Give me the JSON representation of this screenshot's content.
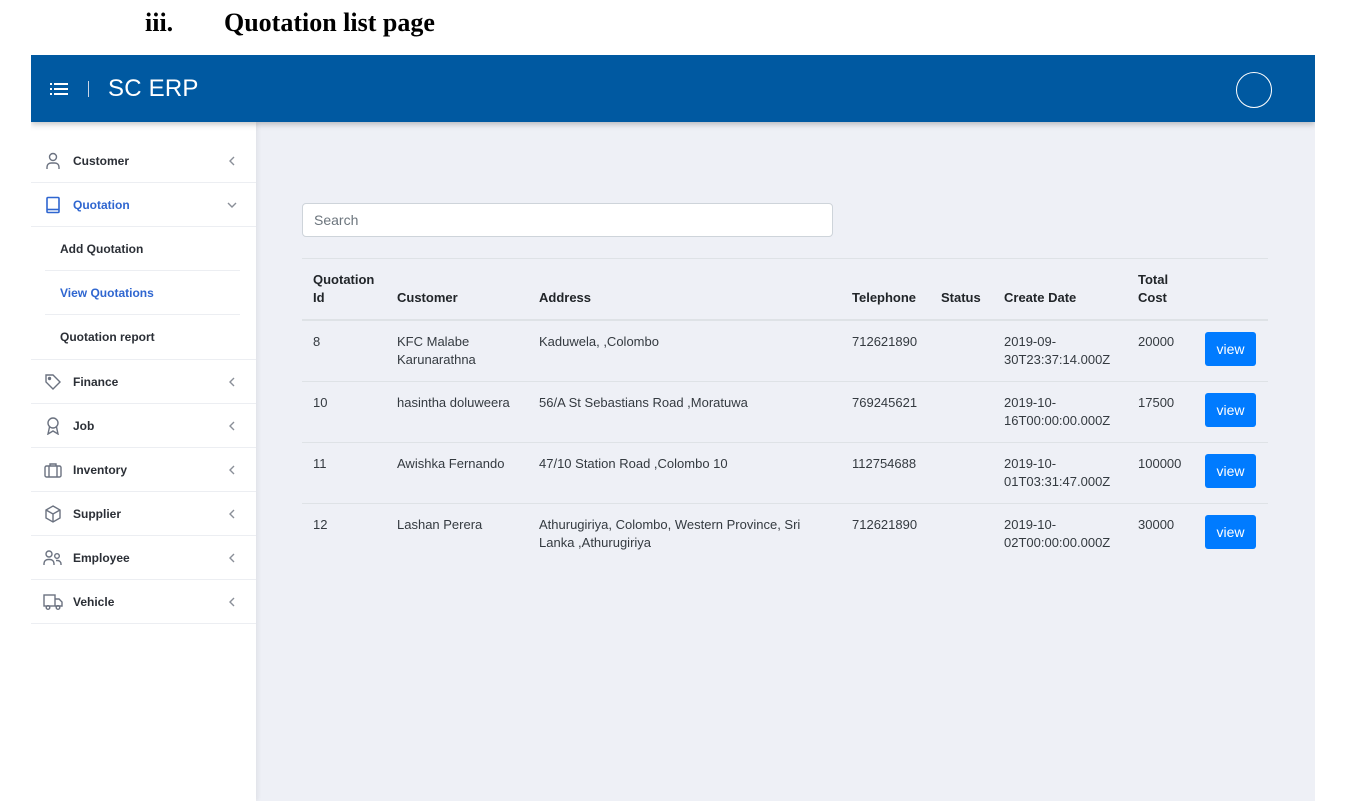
{
  "doc_heading": {
    "number": "iii.",
    "title": "Quotation list page"
  },
  "header": {
    "brand": "SC ERP"
  },
  "sidebar": {
    "items": [
      {
        "label": "Customer",
        "icon": "user-icon"
      },
      {
        "label": "Quotation",
        "icon": "book-icon",
        "active": true,
        "sub_items": [
          {
            "label": "Add Quotation"
          },
          {
            "label": "View Quotations",
            "active": true
          },
          {
            "label": "Quotation report"
          }
        ]
      },
      {
        "label": "Finance",
        "icon": "tag-icon"
      },
      {
        "label": "Job",
        "icon": "award-icon"
      },
      {
        "label": "Inventory",
        "icon": "briefcase-icon"
      },
      {
        "label": "Supplier",
        "icon": "box-icon"
      },
      {
        "label": "Employee",
        "icon": "users-icon"
      },
      {
        "label": "Vehicle",
        "icon": "truck-icon"
      }
    ]
  },
  "search": {
    "placeholder": "Search",
    "value": ""
  },
  "table": {
    "headers": {
      "quotation_id_1": "Quotation",
      "quotation_id_2": "Id",
      "customer": "Customer",
      "address": "Address",
      "telephone": "Telephone",
      "status": "Status",
      "create_date": "Create Date",
      "total_cost_1": "Total",
      "total_cost_2": "Cost"
    },
    "rows": [
      {
        "id": "8",
        "customer": "KFC Malabe Karunarathna",
        "address": "Kaduwela, ,Colombo",
        "telephone": "712621890",
        "status": "",
        "create_date": "2019-09-30T23:37:14.000Z",
        "total_cost": "20000",
        "action": "view"
      },
      {
        "id": "10",
        "customer": "hasintha doluweera",
        "address": "56/A St Sebastians Road ,Moratuwa",
        "telephone": "769245621",
        "status": "",
        "create_date": "2019-10-16T00:00:00.000Z",
        "total_cost": "17500",
        "action": "view"
      },
      {
        "id": "11",
        "customer": "Awishka Fernando",
        "address": "47/10 Station Road ,Colombo 10",
        "telephone": "112754688",
        "status": "",
        "create_date": "2019-10-01T03:31:47.000Z",
        "total_cost": "100000",
        "action": "view"
      },
      {
        "id": "12",
        "customer": "Lashan Perera",
        "address": "Athurugiriya, Colombo, Western Province, Sri Lanka ,Athurugiriya",
        "telephone": "712621890",
        "status": "",
        "create_date": "2019-10-02T00:00:00.000Z",
        "total_cost": "30000",
        "action": "view"
      }
    ]
  },
  "colors": {
    "header_bg": "#0059a1",
    "accent": "#2f66d0",
    "button": "#007bff",
    "content_bg": "#eef0f6"
  }
}
